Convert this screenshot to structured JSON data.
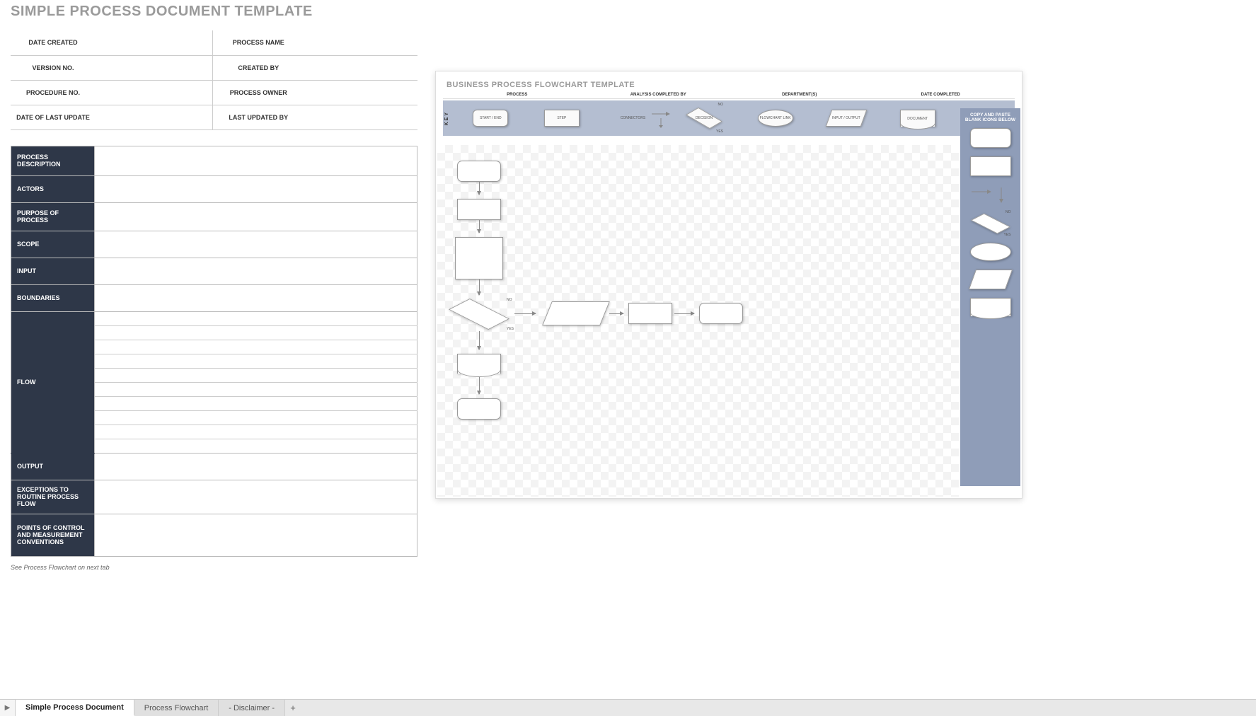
{
  "left": {
    "title": "SIMPLE PROCESS DOCUMENT TEMPLATE",
    "headers": {
      "r1a": "DATE CREATED",
      "r1b": "PROCESS NAME",
      "r2a": "VERSION NO.",
      "r2b": "CREATED BY",
      "r3a": "PROCEDURE NO.",
      "r3b": "PROCESS OWNER",
      "r4a": "DATE OF LAST UPDATE",
      "r4b": "LAST UPDATED BY"
    },
    "sections": {
      "process_description": "PROCESS DESCRIPTION",
      "actors": "ACTORS",
      "purpose": "PURPOSE OF PROCESS",
      "scope": "SCOPE",
      "input": "INPUT",
      "boundaries": "BOUNDARIES",
      "flow": "FLOW",
      "output": "OUTPUT",
      "exceptions": "EXCEPTIONS TO ROUTINE PROCESS FLOW",
      "points": "POINTS OF CONTROL AND MEASUREMENT CONVENTIONS"
    },
    "note": "See Process Flowchart on next tab"
  },
  "right": {
    "title": "BUSINESS PROCESS FLOWCHART TEMPLATE",
    "headers": {
      "h1": "PROCESS",
      "h2": "ANALYSIS COMPLETED BY",
      "h3": "DEPARTMENT(S)",
      "h4": "DATE COMPLETED"
    },
    "key_label": "KEY",
    "key_items": {
      "start_end": "START / END",
      "step": "STEP",
      "connectors": "CONNECTORS",
      "decision": "DECISION",
      "no": "NO",
      "yes": "YES",
      "flowchart_link": "FLOWCHART LINK",
      "input_output": "INPUT / OUTPUT",
      "document": "DOCUMENT"
    },
    "palette_title": "COPY AND PASTE BLANK ICONS BELOW",
    "palette": {
      "no": "NO",
      "yes": "YES"
    }
  },
  "tabs": {
    "t1": "Simple Process Document",
    "t2": "Process Flowchart",
    "t3": "- Disclaimer -",
    "add": "+"
  }
}
